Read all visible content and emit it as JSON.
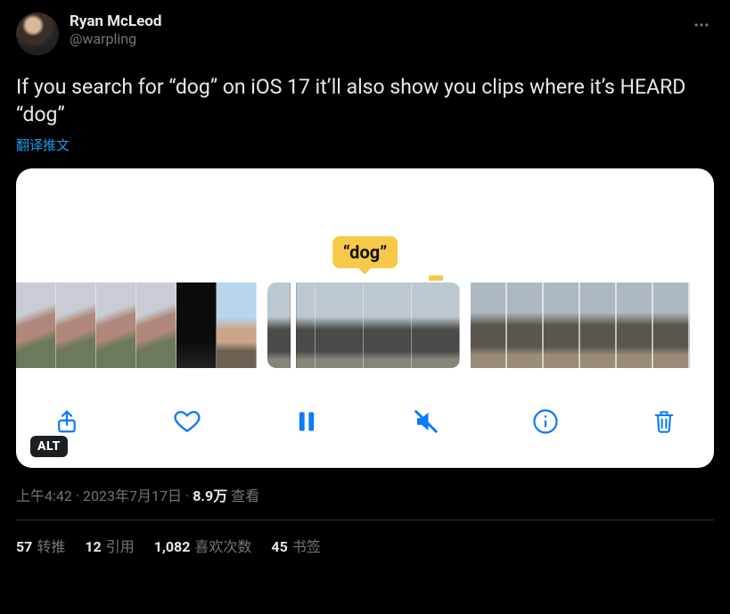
{
  "author": {
    "display_name": "Ryan McLeod",
    "handle": "@warpling"
  },
  "tweet_text": "If you search for “dog” on iOS 17 it’ll also show you clips where it’s HEARD “dog”",
  "translate_label": "翻译推文",
  "media": {
    "tooltip": "“dog”",
    "alt_badge": "ALT"
  },
  "meta": {
    "time": "上午4:42",
    "date": "2023年7月17日",
    "views_count": "8.9万",
    "views_label": "查看"
  },
  "stats": {
    "retweets": {
      "count": "57",
      "label": "转推"
    },
    "quotes": {
      "count": "12",
      "label": "引用"
    },
    "likes": {
      "count": "1,082",
      "label": "喜欢次数"
    },
    "bookmarks": {
      "count": "45",
      "label": "书签"
    }
  }
}
